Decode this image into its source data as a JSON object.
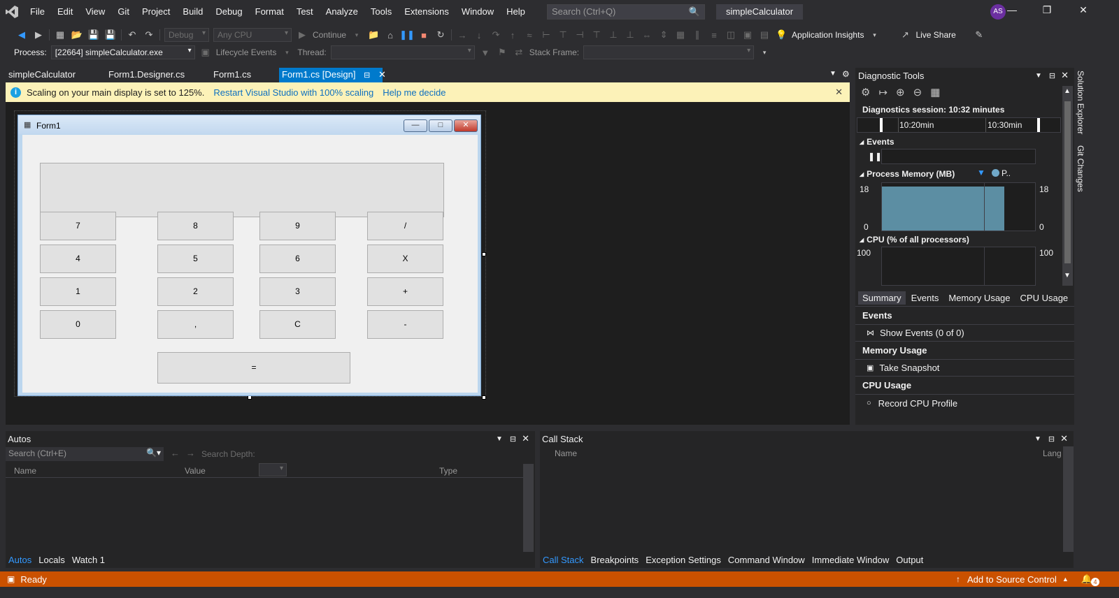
{
  "menu": {
    "items": [
      "File",
      "Edit",
      "View",
      "Git",
      "Project",
      "Build",
      "Debug",
      "Format",
      "Test",
      "Analyze",
      "Tools",
      "Extensions",
      "Window",
      "Help"
    ],
    "search_placeholder": "Search (Ctrl+Q)",
    "solution_title": "simpleCalculator",
    "avatar_initials": "AS"
  },
  "toolbar": {
    "config": "Debug",
    "platform": "Any CPU",
    "continue_label": "Continue",
    "app_insights": "Application Insights",
    "live_share": "Live Share",
    "process_label": "Process:",
    "process_value": "[22664] simpleCalculator.exe",
    "lifecycle_label": "Lifecycle Events",
    "thread_label": "Thread:",
    "stack_frame_label": "Stack Frame:"
  },
  "doc_tabs": [
    "simpleCalculator",
    "Form1.Designer.cs",
    "Form1.cs",
    "Form1.cs [Design]"
  ],
  "infobar": {
    "message": "Scaling on your main display is set to 125%.",
    "link1": "Restart Visual Studio with 100% scaling",
    "link2": "Help me decide"
  },
  "form": {
    "title": "Form1",
    "buttons": [
      "7",
      "8",
      "9",
      "/",
      "4",
      "5",
      "6",
      "X",
      "1",
      "2",
      "3",
      "+",
      "0",
      ",",
      "C",
      "-"
    ],
    "equals": "="
  },
  "diagnostics": {
    "title": "Diagnostic Tools",
    "session": "Diagnostics session: 10:32 minutes",
    "ticks": [
      "10:20min",
      "10:30min"
    ],
    "events_label": "Events",
    "memory_label": "Process Memory (MB)",
    "memory_legend": "P..",
    "memory_max": "18",
    "memory_min": "0",
    "cpu_label": "CPU (% of all processors)",
    "cpu_max": "100",
    "tabs": [
      "Summary",
      "Events",
      "Memory Usage",
      "CPU Usage"
    ],
    "summary": {
      "events_head": "Events",
      "show_events": "Show Events (0 of 0)",
      "memory_head": "Memory Usage",
      "take_snapshot": "Take Snapshot",
      "cpu_head": "CPU Usage",
      "record_cpu": "Record CPU Profile"
    }
  },
  "side_tabs": [
    "Solution Explorer",
    "Git Changes"
  ],
  "autos": {
    "title": "Autos",
    "search_placeholder": "Search (Ctrl+E)",
    "search_depth": "Search Depth:",
    "columns": [
      "Name",
      "Value",
      "Type"
    ],
    "tabs": [
      "Autos",
      "Locals",
      "Watch 1"
    ]
  },
  "callstack": {
    "title": "Call Stack",
    "columns": [
      "Name",
      "Lang"
    ],
    "tabs": [
      "Call Stack",
      "Breakpoints",
      "Exception Settings",
      "Command Window",
      "Immediate Window",
      "Output"
    ]
  },
  "status": {
    "ready": "Ready",
    "source_control": "Add to Source Control",
    "notifications": "4"
  },
  "colors": {
    "accent": "#007acc",
    "status_bar": "#ca5100",
    "memory_fill": "#5c8ea3"
  }
}
